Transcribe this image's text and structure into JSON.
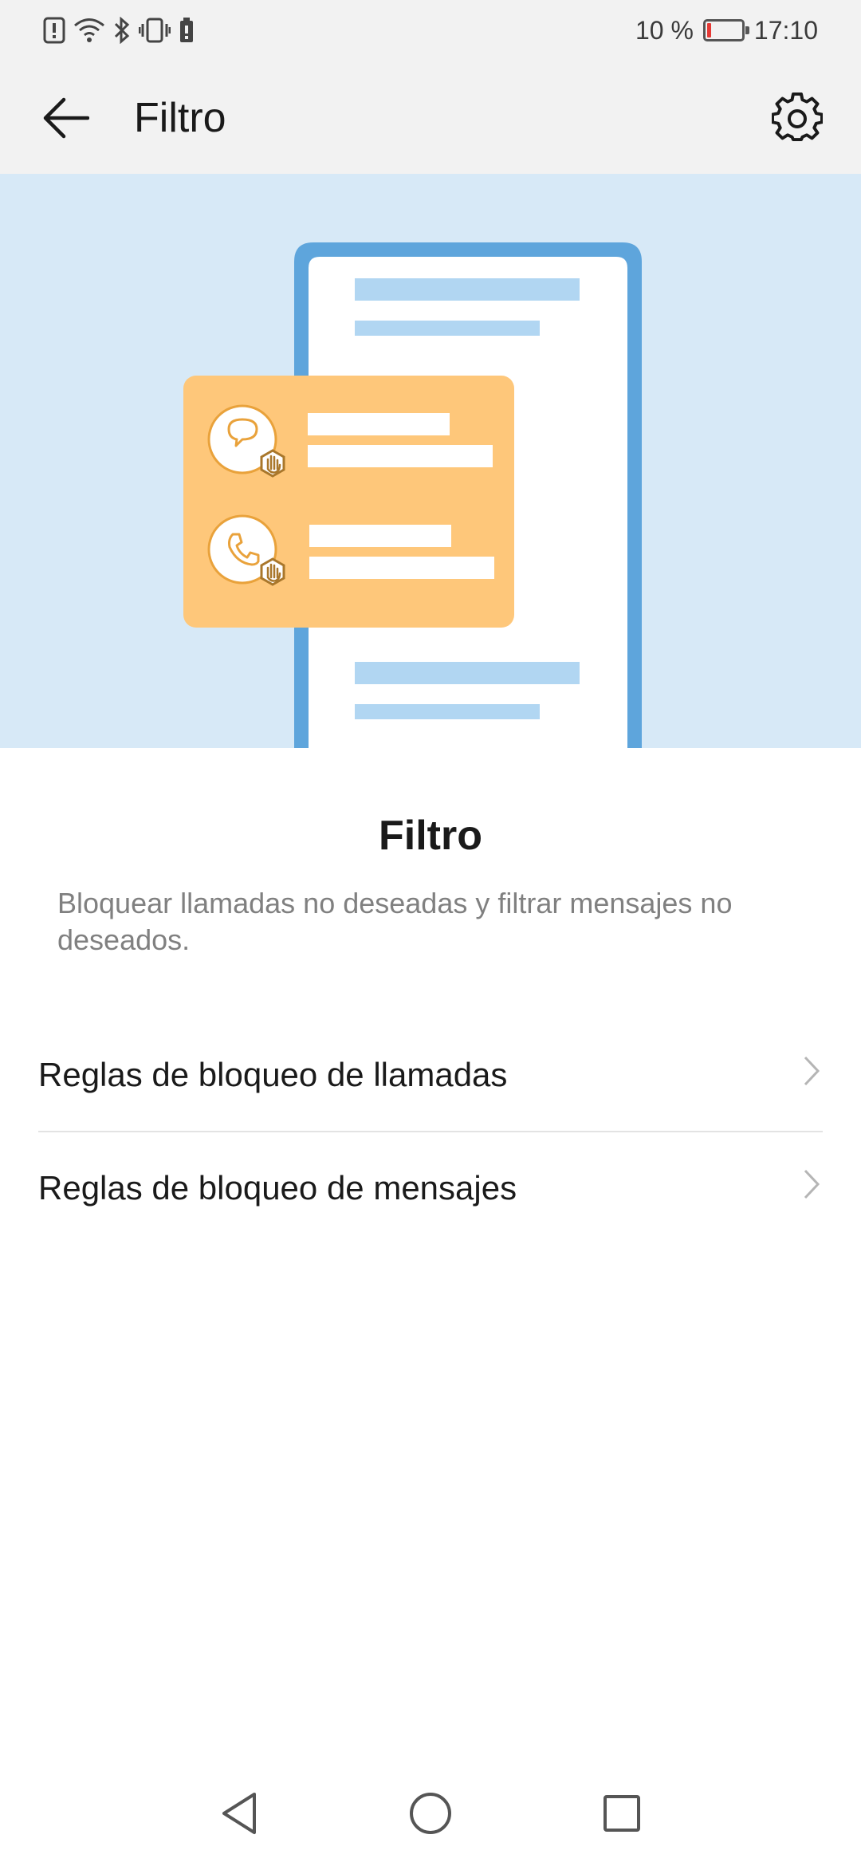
{
  "status_bar": {
    "battery_percent": "10 %",
    "battery_level": 0.1,
    "time": "17:10",
    "icons": [
      "alert-icon",
      "wifi-icon",
      "bluetooth-icon",
      "vibrate-icon",
      "battery-saver-icon"
    ]
  },
  "app_bar": {
    "title": "Filtro",
    "back_icon": "arrow-left-icon",
    "settings_icon": "gear-icon"
  },
  "hero": {
    "illustration": "phone-with-blocked-message-and-call-card",
    "colors": {
      "background": "#d7e9f7",
      "phone_frame": "#5ea5dc",
      "card": "#fec77a",
      "text_lines": "#b1d6f2",
      "icon_stroke": "#e9a23b"
    }
  },
  "content": {
    "title": "Filtro",
    "description": "Bloquear llamadas no deseadas y filtrar mensajes no deseados."
  },
  "list": {
    "items": [
      {
        "label": "Reglas de bloqueo de llamadas"
      },
      {
        "label": "Reglas de bloqueo de mensajes"
      }
    ]
  },
  "nav_bar": {
    "icons": [
      "back-triangle-icon",
      "home-circle-icon",
      "recents-square-icon"
    ]
  }
}
